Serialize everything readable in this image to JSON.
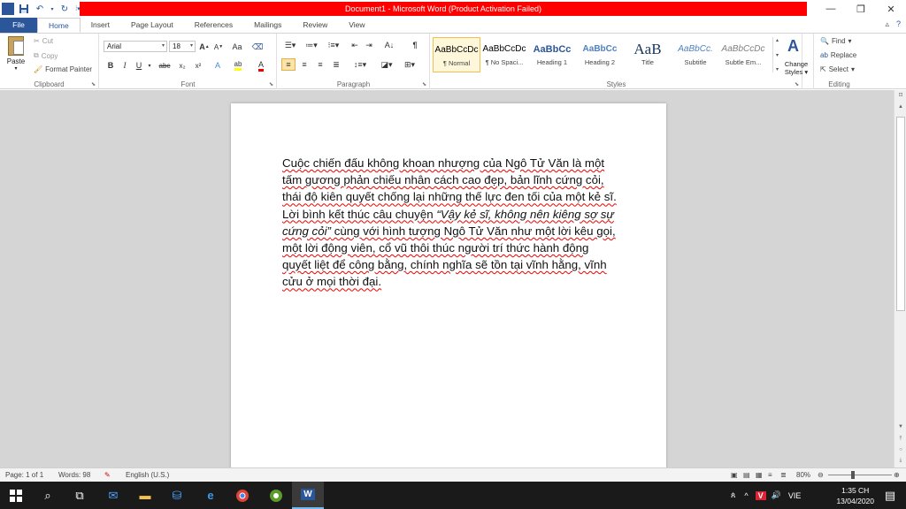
{
  "window": {
    "title": "Document1 - Microsoft Word (Product Activation Failed)"
  },
  "tabs": {
    "file": "File",
    "items": [
      "Home",
      "Insert",
      "Page Layout",
      "References",
      "Mailings",
      "Review",
      "View"
    ]
  },
  "clipboard": {
    "paste": "Paste",
    "cut": "Cut",
    "copy": "Copy",
    "format_painter": "Format Painter",
    "label": "Clipboard"
  },
  "font": {
    "name": "Arial",
    "size": "18",
    "label": "Font",
    "bold": "B",
    "italic": "I",
    "underline": "U",
    "strike": "abc",
    "subscript": "x₂",
    "superscript": "x²",
    "grow": "A",
    "shrink": "A",
    "change_case": "Aa",
    "font_color": "A",
    "highlight": "ab"
  },
  "paragraph": {
    "label": "Paragraph",
    "sort": "A↓",
    "pilcrow": "¶"
  },
  "styles": {
    "label": "Styles",
    "items": [
      {
        "preview": "AaBbCcDc",
        "name": "¶ Normal"
      },
      {
        "preview": "AaBbCcDc",
        "name": "¶ No Spaci..."
      },
      {
        "preview": "AaBbCc",
        "name": "Heading 1"
      },
      {
        "preview": "AaBbCc",
        "name": "Heading 2"
      },
      {
        "preview": "AaB",
        "name": "Title"
      },
      {
        "preview": "AaBbCc.",
        "name": "Subtitle"
      },
      {
        "preview": "AaBbCcDc",
        "name": "Subtle Em..."
      }
    ],
    "change_styles": "Change Styles",
    "change_styles_1": "Change",
    "change_styles_2": "Styles"
  },
  "editing": {
    "label": "Editing",
    "find": "Find",
    "replace": "Replace",
    "select": "Select"
  },
  "document": {
    "p1": "Cuộc chiến đấu không khoan nhượng của Ngô Tử Văn là một tấm gương phản chiếu nhân cách cao đẹp, bản lĩnh cứng cỏi, thái độ kiên quyết chống lại những thế lực đen tối của một kẻ sĩ. Lời bình kết thúc câu chuyện ",
    "quote": "“Vậy kẻ sĩ, không nên kiêng sợ sự cứng cỏi”",
    "p2": " cùng với hình tượng Ngô Tử Văn như một lời kêu gọi, một lời động viên, cổ vũ thôi thúc người trí thức hành động quyết liệt để công bằng, chính nghĩa sẽ tồn tại vĩnh hằng, vĩnh cửu ở mọi thời đại."
  },
  "status": {
    "page": "Page: 1 of 1",
    "words": "Words: 98",
    "language": "English (U.S.)",
    "zoom": "80%"
  },
  "taskbar": {
    "tray_lang": "VIE",
    "time": "1:35 CH",
    "date": "13/04/2020"
  },
  "colors": {
    "brand": "#2b579a",
    "title_bar": "#ff0000",
    "taskbar": "#1a1a1a"
  }
}
